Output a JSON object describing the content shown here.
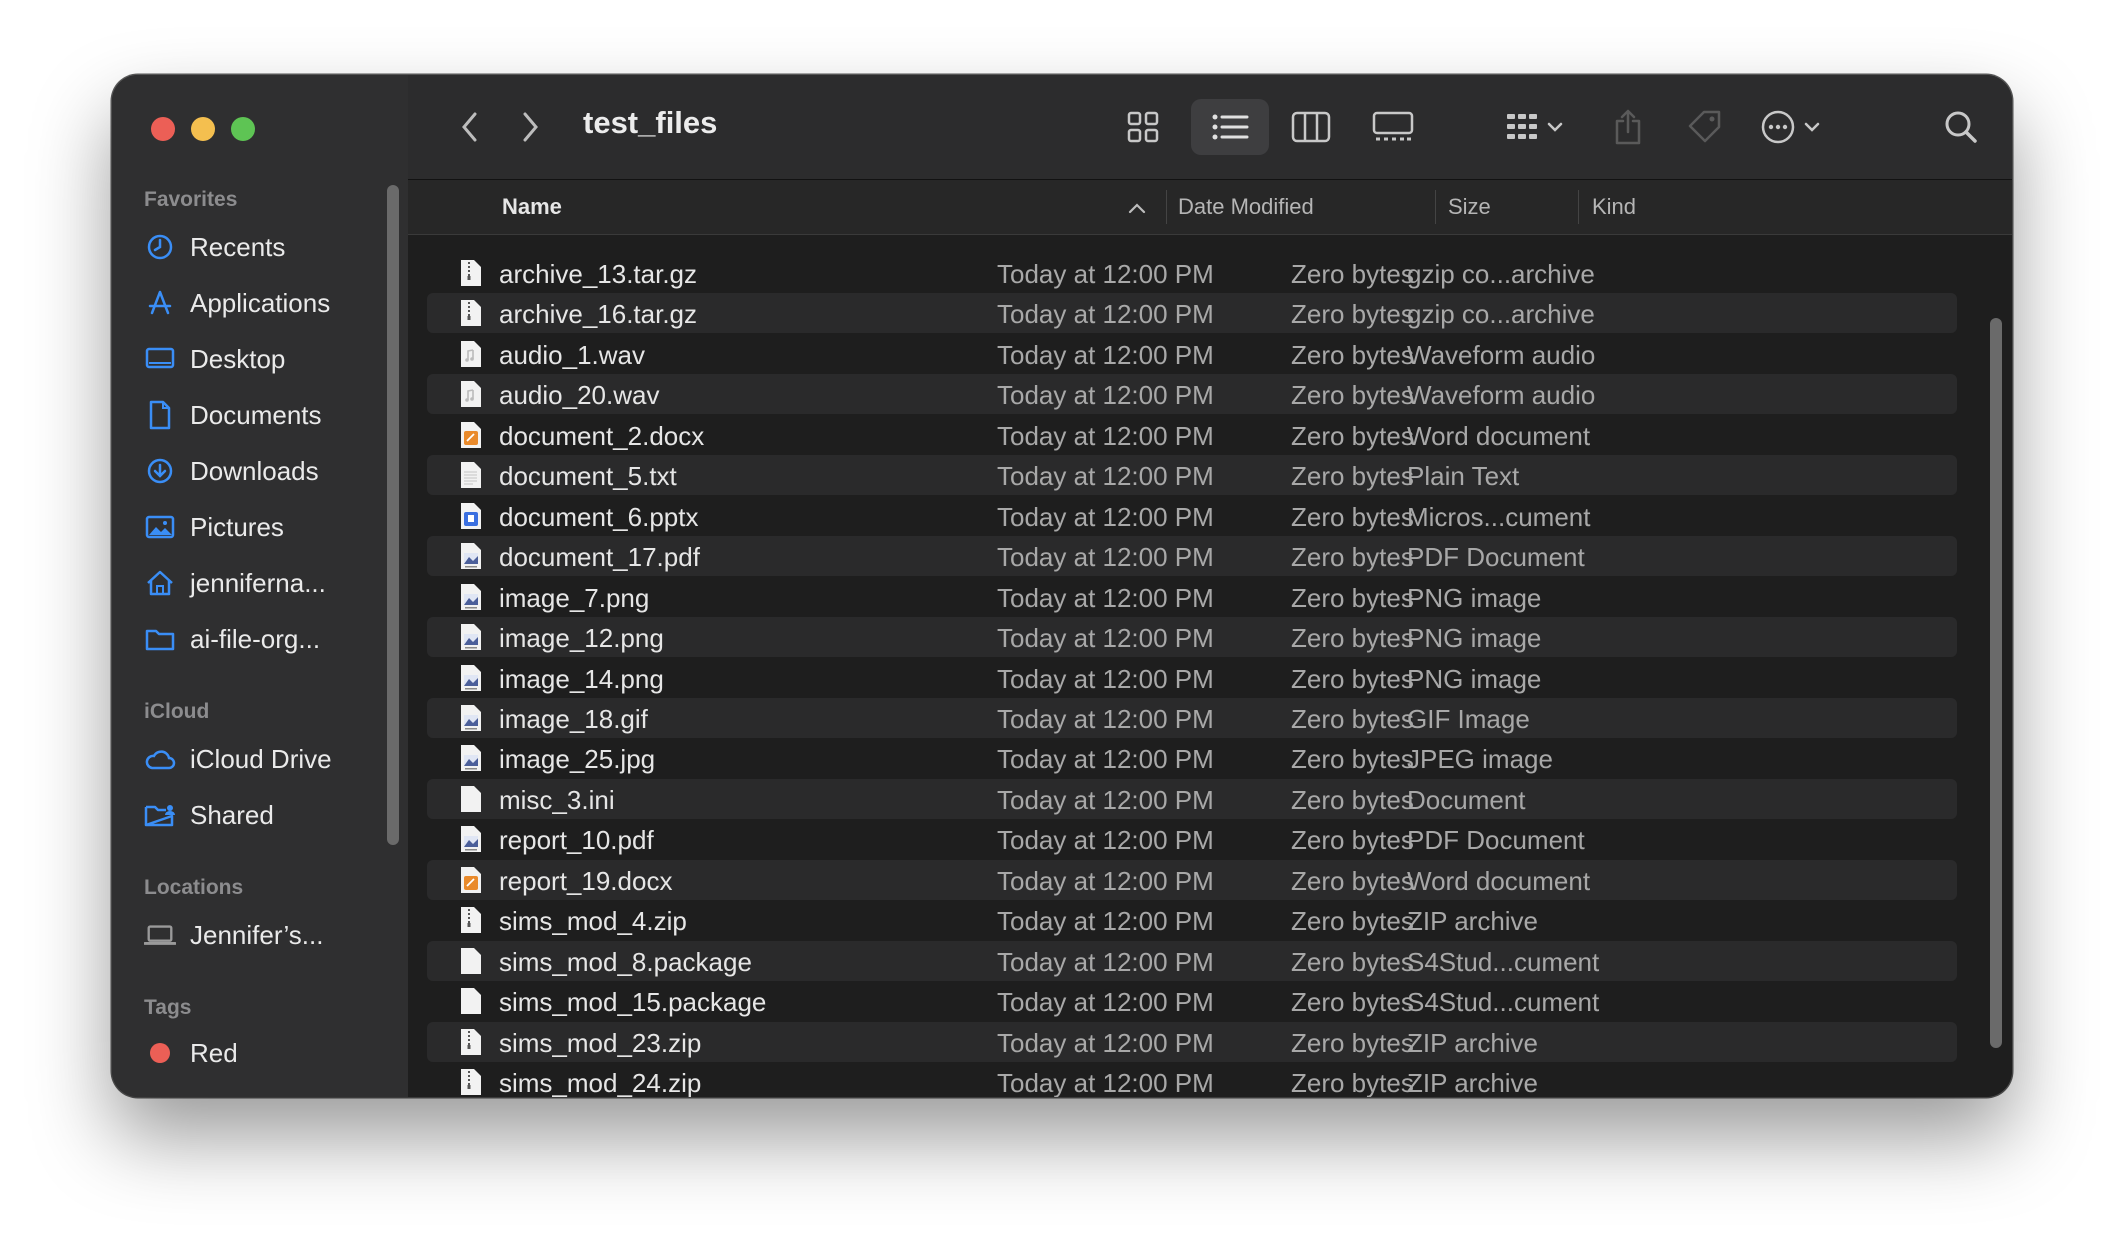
{
  "window": {
    "title": "test_files"
  },
  "sidebar": {
    "sections": {
      "favorites": "Favorites",
      "icloud": "iCloud",
      "locations": "Locations",
      "tags": "Tags"
    },
    "favorites": [
      {
        "label": "Recents",
        "icon": "clock-icon"
      },
      {
        "label": "Applications",
        "icon": "applications-icon"
      },
      {
        "label": "Desktop",
        "icon": "desktop-icon"
      },
      {
        "label": "Documents",
        "icon": "document-icon"
      },
      {
        "label": "Downloads",
        "icon": "download-icon"
      },
      {
        "label": "Pictures",
        "icon": "pictures-icon"
      },
      {
        "label": "jenniferna...",
        "icon": "home-icon"
      },
      {
        "label": "ai-file-org...",
        "icon": "folder-icon"
      }
    ],
    "icloud": [
      {
        "label": "iCloud Drive",
        "icon": "cloud-icon"
      },
      {
        "label": "Shared",
        "icon": "shared-folder-icon"
      }
    ],
    "locations": [
      {
        "label": "Jennifer’s...",
        "icon": "laptop-icon"
      }
    ],
    "tags": [
      {
        "label": "Red",
        "color": "#ec5f56"
      }
    ]
  },
  "columns": {
    "name": "Name",
    "date": "Date Modified",
    "size": "Size",
    "kind": "Kind"
  },
  "files": [
    {
      "name": "archive_13.tar.gz",
      "date": "Today at 12:00 PM",
      "size": "Zero bytes",
      "kind": "gzip co...archive",
      "icon": "archive"
    },
    {
      "name": "archive_16.tar.gz",
      "date": "Today at 12:00 PM",
      "size": "Zero bytes",
      "kind": "gzip co...archive",
      "icon": "archive"
    },
    {
      "name": "audio_1.wav",
      "date": "Today at 12:00 PM",
      "size": "Zero bytes",
      "kind": "Waveform audio",
      "icon": "audio"
    },
    {
      "name": "audio_20.wav",
      "date": "Today at 12:00 PM",
      "size": "Zero bytes",
      "kind": "Waveform audio",
      "icon": "audio"
    },
    {
      "name": "document_2.docx",
      "date": "Today at 12:00 PM",
      "size": "Zero bytes",
      "kind": "Word document",
      "icon": "word"
    },
    {
      "name": "document_5.txt",
      "date": "Today at 12:00 PM",
      "size": "Zero bytes",
      "kind": "Plain Text",
      "icon": "text"
    },
    {
      "name": "document_6.pptx",
      "date": "Today at 12:00 PM",
      "size": "Zero bytes",
      "kind": "Micros...cument",
      "icon": "ppt"
    },
    {
      "name": "document_17.pdf",
      "date": "Today at 12:00 PM",
      "size": "Zero bytes",
      "kind": "PDF Document",
      "icon": "image"
    },
    {
      "name": "image_7.png",
      "date": "Today at 12:00 PM",
      "size": "Zero bytes",
      "kind": "PNG image",
      "icon": "image"
    },
    {
      "name": "image_12.png",
      "date": "Today at 12:00 PM",
      "size": "Zero bytes",
      "kind": "PNG image",
      "icon": "image"
    },
    {
      "name": "image_14.png",
      "date": "Today at 12:00 PM",
      "size": "Zero bytes",
      "kind": "PNG image",
      "icon": "image"
    },
    {
      "name": "image_18.gif",
      "date": "Today at 12:00 PM",
      "size": "Zero bytes",
      "kind": "GIF Image",
      "icon": "image"
    },
    {
      "name": "image_25.jpg",
      "date": "Today at 12:00 PM",
      "size": "Zero bytes",
      "kind": "JPEG image",
      "icon": "image"
    },
    {
      "name": "misc_3.ini",
      "date": "Today at 12:00 PM",
      "size": "Zero bytes",
      "kind": "Document",
      "icon": "blank"
    },
    {
      "name": "report_10.pdf",
      "date": "Today at 12:00 PM",
      "size": "Zero bytes",
      "kind": "PDF Document",
      "icon": "image"
    },
    {
      "name": "report_19.docx",
      "date": "Today at 12:00 PM",
      "size": "Zero bytes",
      "kind": "Word document",
      "icon": "word"
    },
    {
      "name": "sims_mod_4.zip",
      "date": "Today at 12:00 PM",
      "size": "Zero bytes",
      "kind": "ZIP archive",
      "icon": "archive"
    },
    {
      "name": "sims_mod_8.package",
      "date": "Today at 12:00 PM",
      "size": "Zero bytes",
      "kind": "S4Stud...cument",
      "icon": "blank"
    },
    {
      "name": "sims_mod_15.package",
      "date": "Today at 12:00 PM",
      "size": "Zero bytes",
      "kind": "S4Stud...cument",
      "icon": "blank"
    },
    {
      "name": "sims_mod_23.zip",
      "date": "Today at 12:00 PM",
      "size": "Zero bytes",
      "kind": "ZIP archive",
      "icon": "archive"
    },
    {
      "name": "sims_mod_24.zip",
      "date": "Today at 12:00 PM",
      "size": "Zero bytes",
      "kind": "ZIP archive",
      "icon": "archive"
    }
  ],
  "colors": {
    "accent": "#3a8ef6",
    "window_bg": "#1f1f1f",
    "sidebar_bg": "#2f2f30"
  }
}
